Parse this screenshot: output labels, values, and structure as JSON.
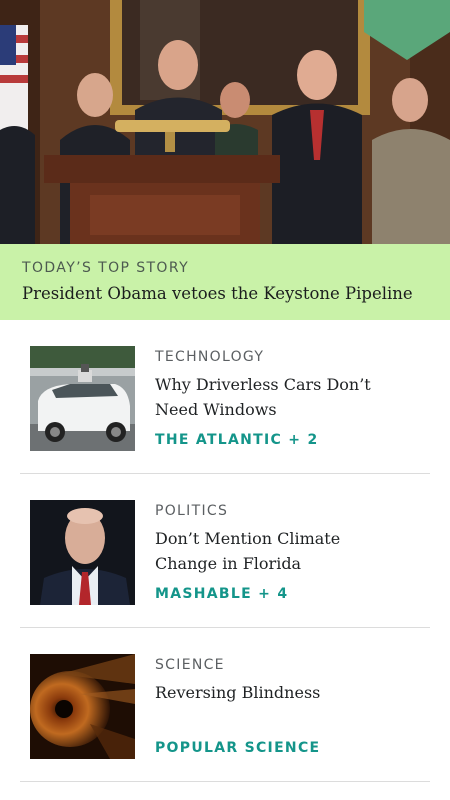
{
  "colors": {
    "top_story_band": "#c9f2a8",
    "source_accent": "#14958a",
    "bookmark": "#5aa77a",
    "divider": "#dcdcdc"
  },
  "hero": {
    "image": "press-conference-photo",
    "bookmark_icon": "bookmark-ribbon-icon"
  },
  "top_story": {
    "kicker": "TODAY’S TOP STORY",
    "title": "President Obama vetoes the Keystone Pipeline"
  },
  "articles": [
    {
      "category": "TECHNOLOGY",
      "headline": "Why Driverless Cars Don’t Need Windows",
      "source": "THE ATLANTIC + 2",
      "thumbnail": "driverless-car-photo"
    },
    {
      "category": "POLITICS",
      "headline": "Don’t Mention Climate Change in Florida",
      "source": "MASHABLE + 4",
      "thumbnail": "politician-portrait-photo"
    },
    {
      "category": "SCIENCE",
      "headline": "Reversing Blindness",
      "source": "POPULAR SCIENCE",
      "thumbnail": "eye-closeup-photo"
    }
  ]
}
